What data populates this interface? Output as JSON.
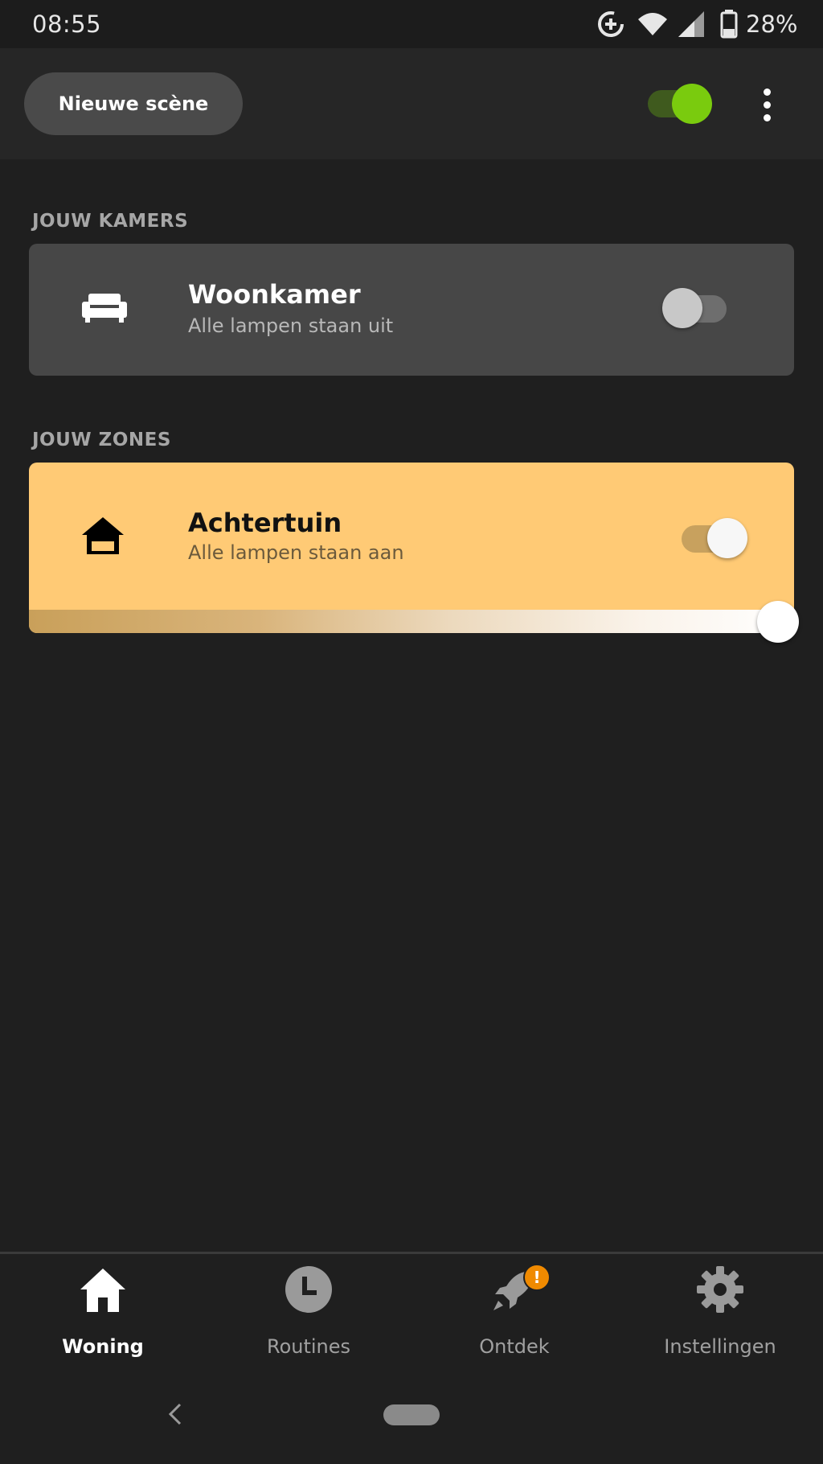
{
  "status_bar": {
    "time": "08:55",
    "battery": "28%"
  },
  "header": {
    "new_scene_label": "Nieuwe scène",
    "master_toggle_on": true
  },
  "rooms": {
    "section_title": "JOUW KAMERS",
    "items": [
      {
        "name": "Woonkamer",
        "status": "Alle lampen staan uit",
        "on": false,
        "icon": "sofa-icon"
      }
    ]
  },
  "zones": {
    "section_title": "JOUW ZONES",
    "items": [
      {
        "name": "Achtertuin",
        "status": "Alle lampen staan aan",
        "on": true,
        "brightness": 1.0,
        "icon": "house-icon"
      }
    ]
  },
  "bottom_nav": {
    "items": [
      {
        "label": "Woning",
        "icon": "home-icon",
        "active": true
      },
      {
        "label": "Routines",
        "icon": "clock-icon",
        "active": false
      },
      {
        "label": "Ontdek",
        "icon": "rocket-icon",
        "active": false,
        "badge": "!"
      },
      {
        "label": "Instellingen",
        "icon": "gear-icon",
        "active": false
      }
    ]
  },
  "colors": {
    "accent_green": "#7acb0e",
    "zone_card": "#ffca75",
    "room_card": "#474747",
    "badge": "#f08a00"
  }
}
